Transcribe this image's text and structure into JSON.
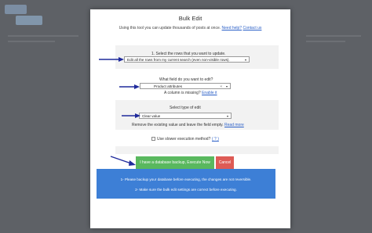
{
  "modal": {
    "title": "Bulk Edit",
    "intro_text": "Using this tool you can update thousands of posts at once.",
    "intro_link_help": "Need help?",
    "intro_link_contact": "Contact us"
  },
  "step1": {
    "label": "1. Select the rows that you want to update.",
    "select_value": "Edit all the rows from my current search (even non-visible rows)."
  },
  "step2": {
    "label": "What field do you want to edit?",
    "select_value": "Product attributes",
    "missing_text": "A column is missing?",
    "enable_link": "Enable it"
  },
  "step3": {
    "label": "Select type of edit",
    "select_value": "Clear value",
    "help_text": "Remove the existing value and leave the field empty.",
    "read_more": "Read more"
  },
  "slower": {
    "label": "Use slower execution method?",
    "help_link": "( ? )"
  },
  "buttons": {
    "execute": "I have a database backup, Execute Now",
    "cancel": "Cancel"
  },
  "info": {
    "line1": "1- Please backup your database before executing, the changes are not reversible.",
    "line2": "2- Make sure the bulk edit settings are correct before executing."
  },
  "colors": {
    "execute_button": "#59b85e",
    "cancel_button": "#de5b55",
    "info_box": "#3d7fd6",
    "annotation_arrow": "#1f2a9c"
  },
  "icons": {
    "select_arrow": "chevron-down-icon",
    "clear": "clear-x-icon",
    "annotation": "annotation-arrow-icon"
  }
}
